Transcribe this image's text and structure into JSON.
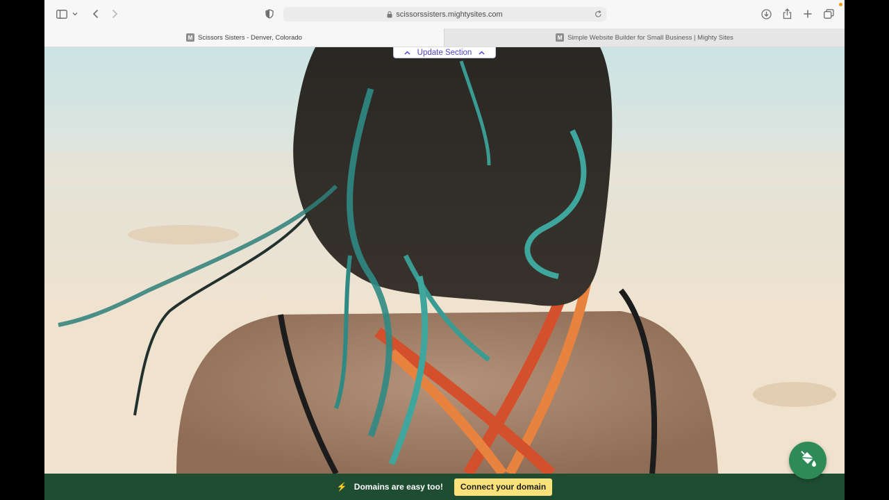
{
  "browser": {
    "url": "scissorssisters.mightysites.com",
    "tabs": [
      {
        "label": "Scissors Sisters - Denver, Colorado",
        "favicon": "M",
        "active": true
      },
      {
        "label": "Simple Website Builder for Small Business | Mighty Sites",
        "favicon": "M",
        "active": false
      }
    ],
    "icons": [
      "sidebar-icon",
      "chevron-down-icon",
      "back-icon",
      "forward-icon",
      "privacy-shield-icon",
      "lock-icon",
      "reload-icon",
      "download-icon",
      "share-icon",
      "new-tab-icon",
      "tab-overview-icon"
    ]
  },
  "editor": {
    "update_section_label": "Update Section"
  },
  "banner": {
    "text": "Domains are easy too!",
    "button_label": "Connect your domain",
    "bolt_glyph": "⚡"
  },
  "colors": {
    "banner_bg": "#1f4d32",
    "button_bg": "#fbe27a",
    "fab_bg": "#2e8b57",
    "accent": "#4f46c8"
  }
}
